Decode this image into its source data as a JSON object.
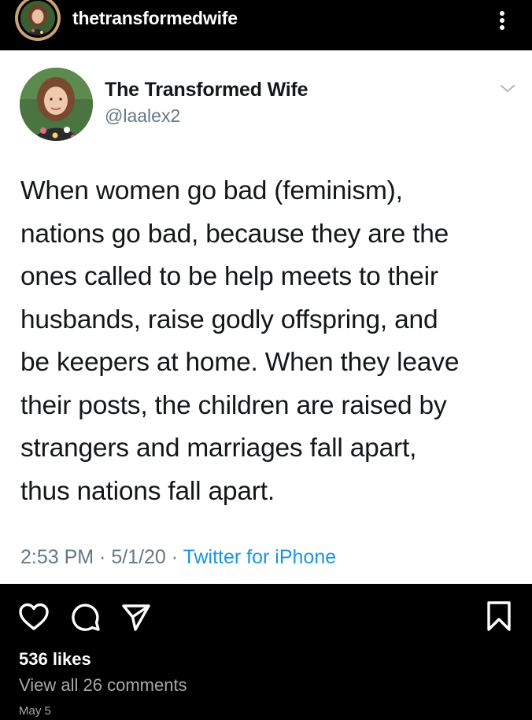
{
  "post": {
    "username": "thetransformedwife",
    "likes": "536 likes",
    "view_comments": "View all 26 comments",
    "date": "May 5"
  },
  "tweet": {
    "display_name": "The Transformed Wife",
    "handle": "@laalex2",
    "lines": [
      "When women go bad (feminism),",
      "nations go bad, because they are the",
      "ones called to be help meets to their",
      "husbands, raise godly offspring, and",
      "be keepers at home. When they leave",
      "their posts, the children are raised by",
      "strangers and marriages fall apart,",
      "thus nations fall apart."
    ],
    "time": "2:53 PM",
    "date": "5/1/20",
    "separator": " · ",
    "source": "Twitter for iPhone"
  },
  "icons": {
    "more": "more-options-icon",
    "chevron": "chevron-down-icon",
    "like": "heart-icon",
    "comment": "comment-icon",
    "share": "send-icon",
    "save": "bookmark-icon"
  },
  "colors": {
    "background": "#000000",
    "tweet_background": "#ffffff",
    "tweet_text": "#14171a",
    "muted": "#657786",
    "link": "#1b95e0",
    "ig_muted": "#a8a8a8"
  }
}
